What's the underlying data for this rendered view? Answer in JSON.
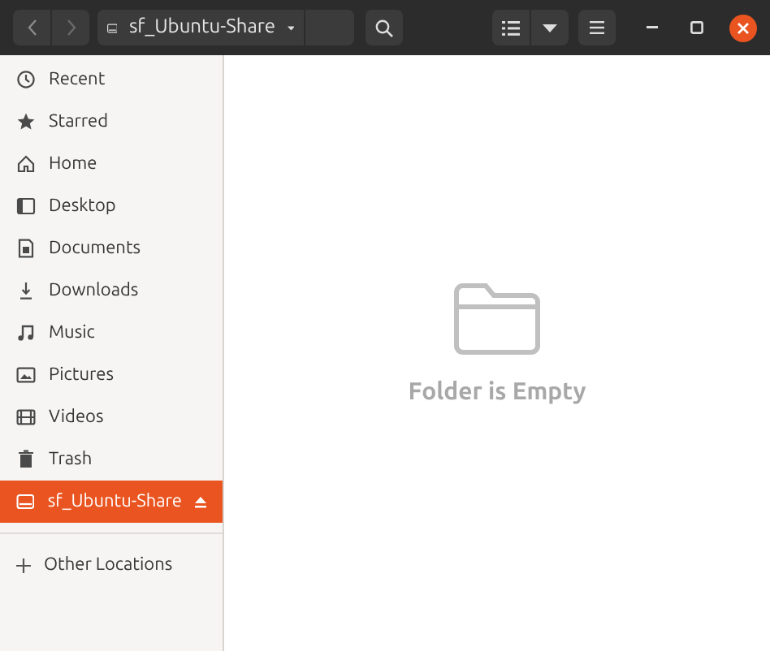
{
  "header": {
    "location": "sf_Ubuntu-Share"
  },
  "sidebar": {
    "items": [
      {
        "label": "Recent",
        "kind": "clock",
        "selected": false
      },
      {
        "label": "Starred",
        "kind": "star",
        "selected": false
      },
      {
        "label": "Home",
        "kind": "home",
        "selected": false
      },
      {
        "label": "Desktop",
        "kind": "desktop",
        "selected": false
      },
      {
        "label": "Documents",
        "kind": "doc",
        "selected": false
      },
      {
        "label": "Downloads",
        "kind": "download",
        "selected": false
      },
      {
        "label": "Music",
        "kind": "music",
        "selected": false
      },
      {
        "label": "Pictures",
        "kind": "picture",
        "selected": false
      },
      {
        "label": "Videos",
        "kind": "video",
        "selected": false
      },
      {
        "label": "Trash",
        "kind": "trash",
        "selected": false
      },
      {
        "label": "sf_Ubuntu-Share",
        "kind": "drive",
        "selected": true,
        "ejectable": true
      }
    ],
    "other": "Other Locations"
  },
  "content": {
    "empty_message": "Folder is Empty"
  }
}
